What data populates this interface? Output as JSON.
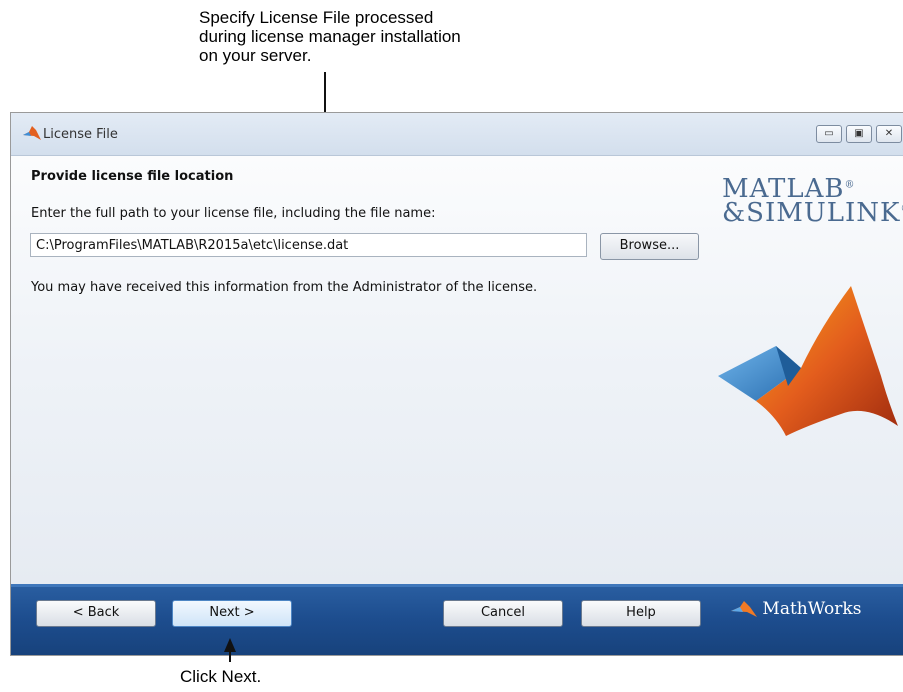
{
  "annotations": {
    "top_callout": [
      "Specify License File processed",
      "during license manager installation",
      "on your server."
    ],
    "bottom_callout": "Click Next."
  },
  "window": {
    "title": "License File",
    "controls": {
      "minimize": "▭",
      "maximize": "▣",
      "close": "✕"
    }
  },
  "content": {
    "heading": "Provide license file location",
    "instruction": "Enter the full path to your license file, including the file name:",
    "license_path_value": "C:\\ProgramFiles\\MATLAB\\R2015a\\etc\\license.dat",
    "browse_label": "Browse...",
    "info_text": "You may have received this information from the Administrator of the license."
  },
  "branding": {
    "logo_line1": "MATLAB",
    "logo_line2": "&SIMULINK",
    "reg_mark": "®",
    "footer_logo": "MathWorks",
    "colors": {
      "logo_text": "#4a6a90",
      "footer_bg": "#1d4d8e",
      "peaks_orange": "#e35d1d",
      "peaks_blue": "#3f8ed6"
    }
  },
  "footer": {
    "back_label": "< Back",
    "next_label": "Next >",
    "cancel_label": "Cancel",
    "help_label": "Help"
  }
}
